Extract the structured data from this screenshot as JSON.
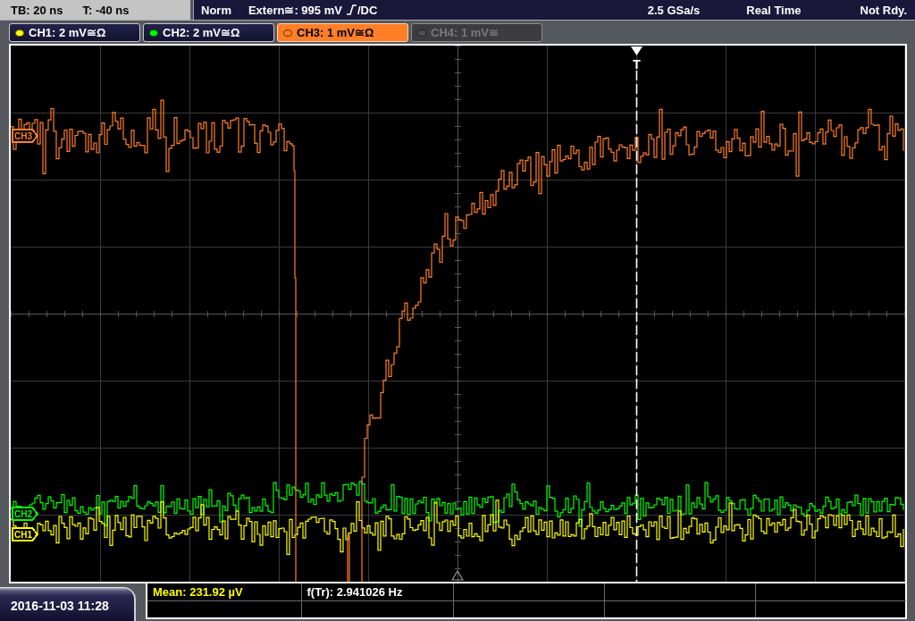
{
  "status_bar": {
    "timebase": "TB: 20 ns",
    "trigger_time": "T: -40 ns",
    "trigger_mode": "Norm",
    "trigger_level": "Extern≅: 995 mV",
    "trigger_coupling": "/DC",
    "sample_rate": "2.5 GSa/s",
    "acquisition_mode": "Real Time",
    "ready_state": "Not Rdy."
  },
  "channels": [
    {
      "label": "CH1: 2 mV≅Ω",
      "color": "#ffff00",
      "selected": false,
      "disabled": false
    },
    {
      "label": "CH2: 2 mV≅Ω",
      "color": "#00ff00",
      "selected": false,
      "disabled": false
    },
    {
      "label": "CH3: 1 mV≅Ω",
      "color": "#ff7f27",
      "selected": true,
      "disabled": false
    },
    {
      "label": "CH4: 1 mV≅",
      "color": "#505050",
      "selected": false,
      "disabled": true
    }
  ],
  "display": {
    "trigger_marker": "T",
    "trace_markers": [
      {
        "label": "CH3",
        "color": "#ff7f27"
      },
      {
        "label": "CH2",
        "color": "#00ff00"
      },
      {
        "label": "CH1",
        "color": "#ffff00"
      }
    ]
  },
  "date_time": "2016-11-03 11:28",
  "measurements": [
    {
      "label": "Mean: 231.92 µV",
      "color": "#ffff00"
    },
    {
      "label": "f(Tr): 2.941026 Hz",
      "color": "#ffffff"
    }
  ]
}
